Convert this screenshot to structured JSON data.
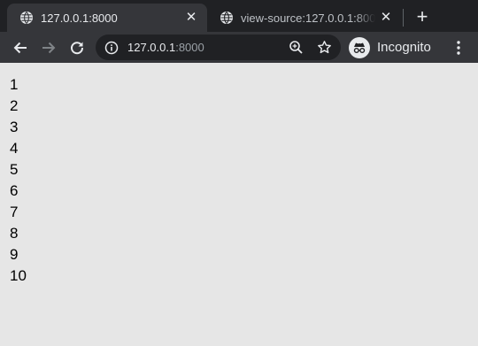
{
  "tabs": [
    {
      "title": "127.0.0.1:8000",
      "active": true,
      "close_icon": "close-icon",
      "favicon": "globe-icon"
    },
    {
      "title": "view-source:127.0.0.1:8000",
      "active": false,
      "close_icon": "close-icon",
      "favicon": "globe-icon"
    }
  ],
  "new_tab_label": "+",
  "toolbar": {
    "back_icon": "arrow-left-icon",
    "forward_icon": "arrow-right-icon",
    "reload_icon": "reload-icon",
    "url_host": "127.0.0.1",
    "url_port": ":8000",
    "info_icon": "info-icon",
    "zoom_icon": "zoom-icon",
    "bookmark_icon": "star-icon",
    "incognito_label": "Incognito",
    "menu_icon": "kebab-menu-icon"
  },
  "page": {
    "lines": [
      "1",
      "2",
      "3",
      "4",
      "5",
      "6",
      "7",
      "8",
      "9",
      "10"
    ]
  },
  "colors": {
    "tabstrip": "#202124",
    "toolbar": "#35363a",
    "page_background": "#e6e6e6"
  }
}
